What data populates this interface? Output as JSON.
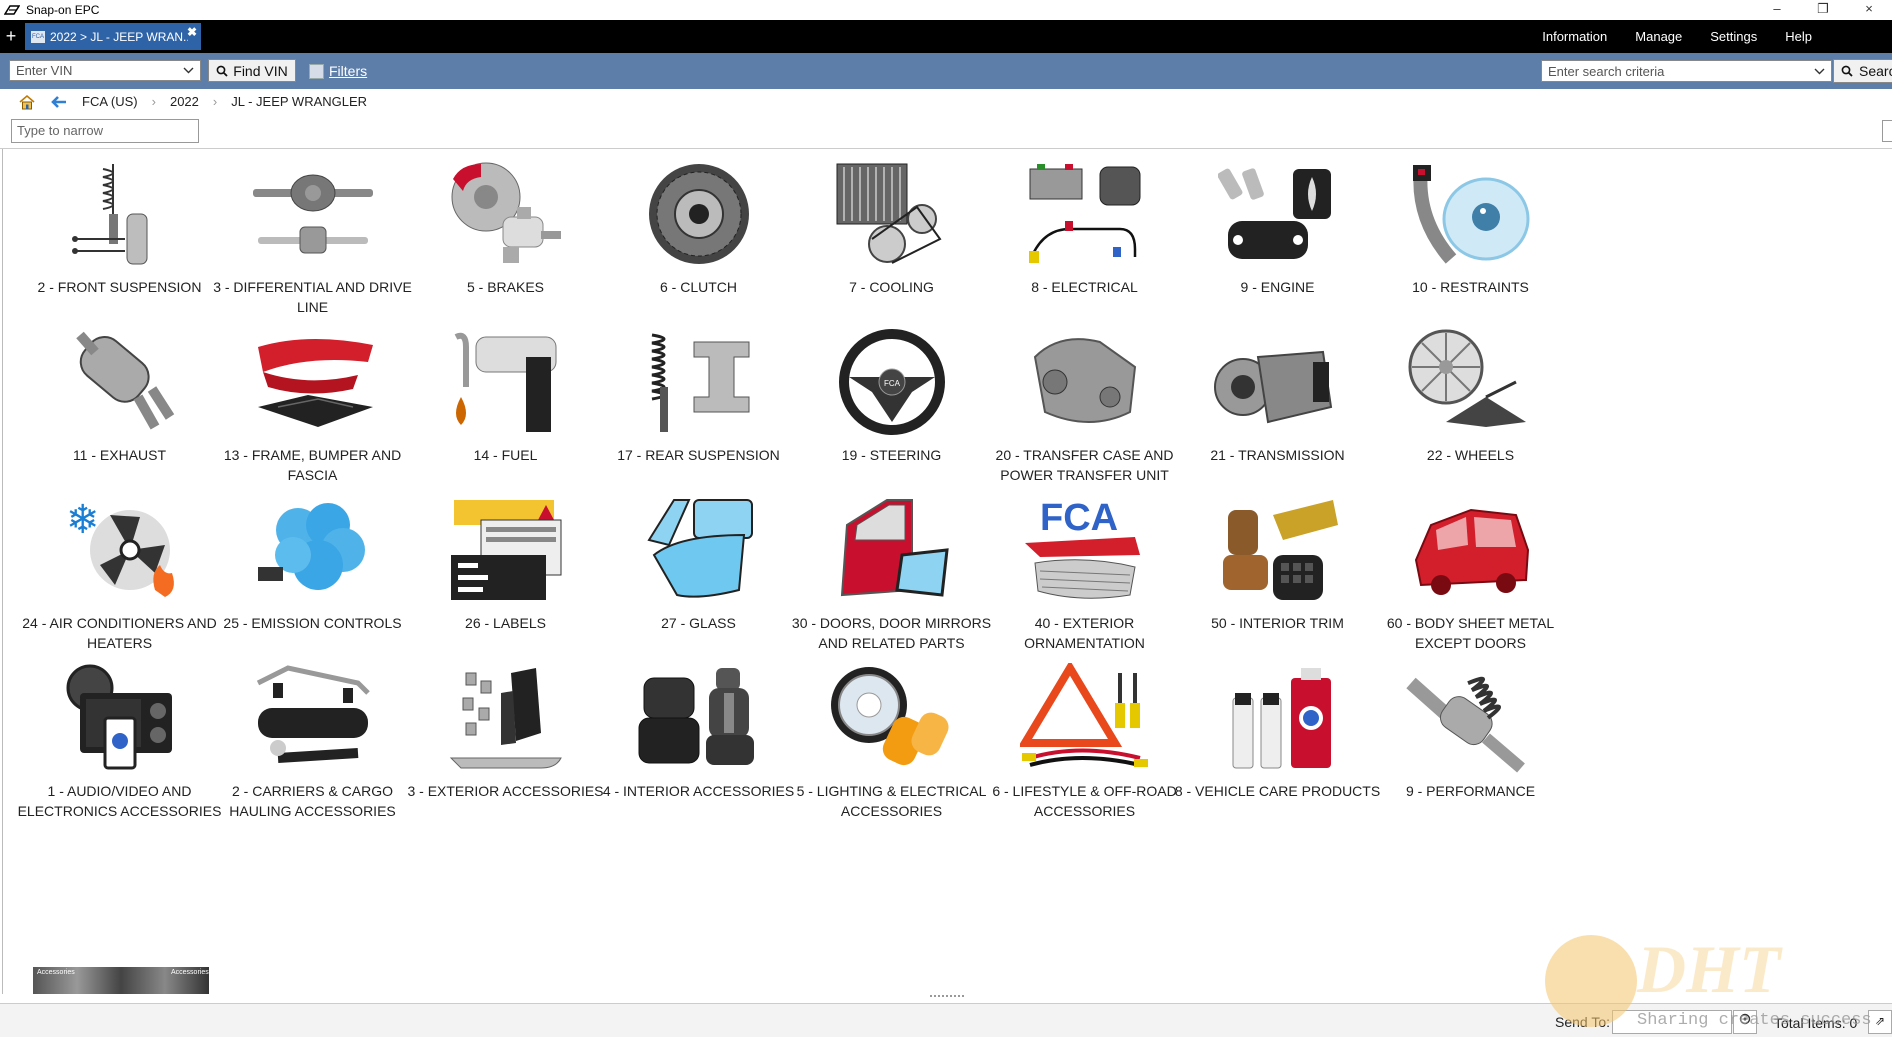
{
  "window": {
    "title": "Snap-on EPC",
    "minimize": "–",
    "restore": "❐",
    "close": "×"
  },
  "tab": {
    "label": "2022 > JL - JEEP WRAN...",
    "add": "+",
    "close": "✖",
    "icon_text": "FCA"
  },
  "top_menu": [
    "Information",
    "Manage",
    "Settings",
    "Help"
  ],
  "vin": {
    "placeholder": "Enter VIN",
    "find_label": "Find VIN",
    "filters_label": "Filters"
  },
  "search": {
    "placeholder": "Enter search criteria",
    "button_label": "Search"
  },
  "breadcrumb": [
    "FCA (US)",
    "2022",
    "JL - JEEP WRANGLER"
  ],
  "narrow": {
    "placeholder": "Type to narrow"
  },
  "categories": [
    {
      "label": "2 - FRONT SUSPENSION",
      "icon": "front-suspension-icon",
      "color": "#9a9a9a"
    },
    {
      "label": "3 - DIFFERENTIAL AND DRIVE LINE",
      "icon": "differential-icon",
      "color": "#7a7a7a"
    },
    {
      "label": "5 - BRAKES",
      "icon": "brakes-icon",
      "color": "#c8102e"
    },
    {
      "label": "6 - CLUTCH",
      "icon": "clutch-icon",
      "color": "#333333"
    },
    {
      "label": "7 - COOLING",
      "icon": "cooling-icon",
      "color": "#555555"
    },
    {
      "label": "8 - ELECTRICAL",
      "icon": "electrical-icon",
      "color": "#333333"
    },
    {
      "label": "9 - ENGINE",
      "icon": "engine-icon",
      "color": "#222222"
    },
    {
      "label": "10 - RESTRAINTS",
      "icon": "restraints-icon",
      "color": "#a8d8f0"
    },
    {
      "label": "11 - EXHAUST",
      "icon": "exhaust-icon",
      "color": "#8a8a8a"
    },
    {
      "label": "13 - FRAME, BUMPER AND FASCIA",
      "icon": "frame-bumper-icon",
      "color": "#d21f2b"
    },
    {
      "label": "14 - FUEL",
      "icon": "fuel-icon",
      "color": "#cc6600"
    },
    {
      "label": "17 - REAR SUSPENSION",
      "icon": "rear-suspension-icon",
      "color": "#444444"
    },
    {
      "label": "19 - STEERING",
      "icon": "steering-wheel-icon",
      "color": "#222222"
    },
    {
      "label": "20 - TRANSFER CASE AND POWER TRANSFER UNIT",
      "icon": "transfer-case-icon",
      "color": "#999999"
    },
    {
      "label": "21 - TRANSMISSION",
      "icon": "transmission-icon",
      "color": "#888888"
    },
    {
      "label": "22 - WHEELS",
      "icon": "wheel-jack-icon",
      "color": "#888888"
    },
    {
      "label": "24 - AIR CONDITIONERS AND HEATERS",
      "icon": "air-conditioner-icon",
      "color": "#1a7fd4"
    },
    {
      "label": "25 - EMISSION CONTROLS",
      "icon": "emission-cloud-icon",
      "color": "#3aa6e6"
    },
    {
      "label": "26 - LABELS",
      "icon": "labels-icon",
      "color": "#f4c430"
    },
    {
      "label": "27 - GLASS",
      "icon": "glass-icon",
      "color": "#6fc8ef"
    },
    {
      "label": "30 - DOORS, DOOR MIRRORS AND RELATED PARTS",
      "icon": "door-mirror-icon",
      "color": "#c8102e"
    },
    {
      "label": "40 - EXTERIOR ORNAMENTATION",
      "icon": "fca-grille-icon",
      "color": "#2f63c8"
    },
    {
      "label": "50 - INTERIOR TRIM",
      "icon": "interior-trim-icon",
      "color": "#8b5a2b"
    },
    {
      "label": "60 - BODY SHEET METAL EXCEPT DOORS",
      "icon": "body-shell-icon",
      "color": "#d21f2b"
    },
    {
      "label": "1 - AUDIO/VIDEO AND ELECTRONICS ACCESSORIES",
      "icon": "audio-video-icon",
      "color": "#333333"
    },
    {
      "label": "2 - CARRIERS & CARGO HAULING ACCESSORIES",
      "icon": "carrier-icon",
      "color": "#333333"
    },
    {
      "label": "3 - EXTERIOR ACCESSORIES",
      "icon": "mud-flap-icon",
      "color": "#333333"
    },
    {
      "label": "4 - INTERIOR ACCESSORIES",
      "icon": "floor-mat-seat-icon",
      "color": "#333333"
    },
    {
      "label": "5 - LIGHTING & ELECTRICAL ACCESSORIES",
      "icon": "headlamp-icon",
      "color": "#f39c12"
    },
    {
      "label": "6 - LIFESTYLE & OFF-ROAD ACCESSORIES",
      "icon": "warning-triangle-icon",
      "color": "#e8481c"
    },
    {
      "label": "8 - VEHICLE CARE PRODUCTS",
      "icon": "care-products-icon",
      "color": "#c8102e"
    },
    {
      "label": "9 - PERFORMANCE",
      "icon": "performance-icon",
      "color": "#888888"
    }
  ],
  "partial_tile": [
    "Accessories",
    "Accessories"
  ],
  "status": {
    "send_to": "Send To:",
    "total_items": "Total Items: 0",
    "expand": "⇗"
  },
  "watermark": {
    "text": "DHT",
    "sharing": "Sharing creates success"
  }
}
